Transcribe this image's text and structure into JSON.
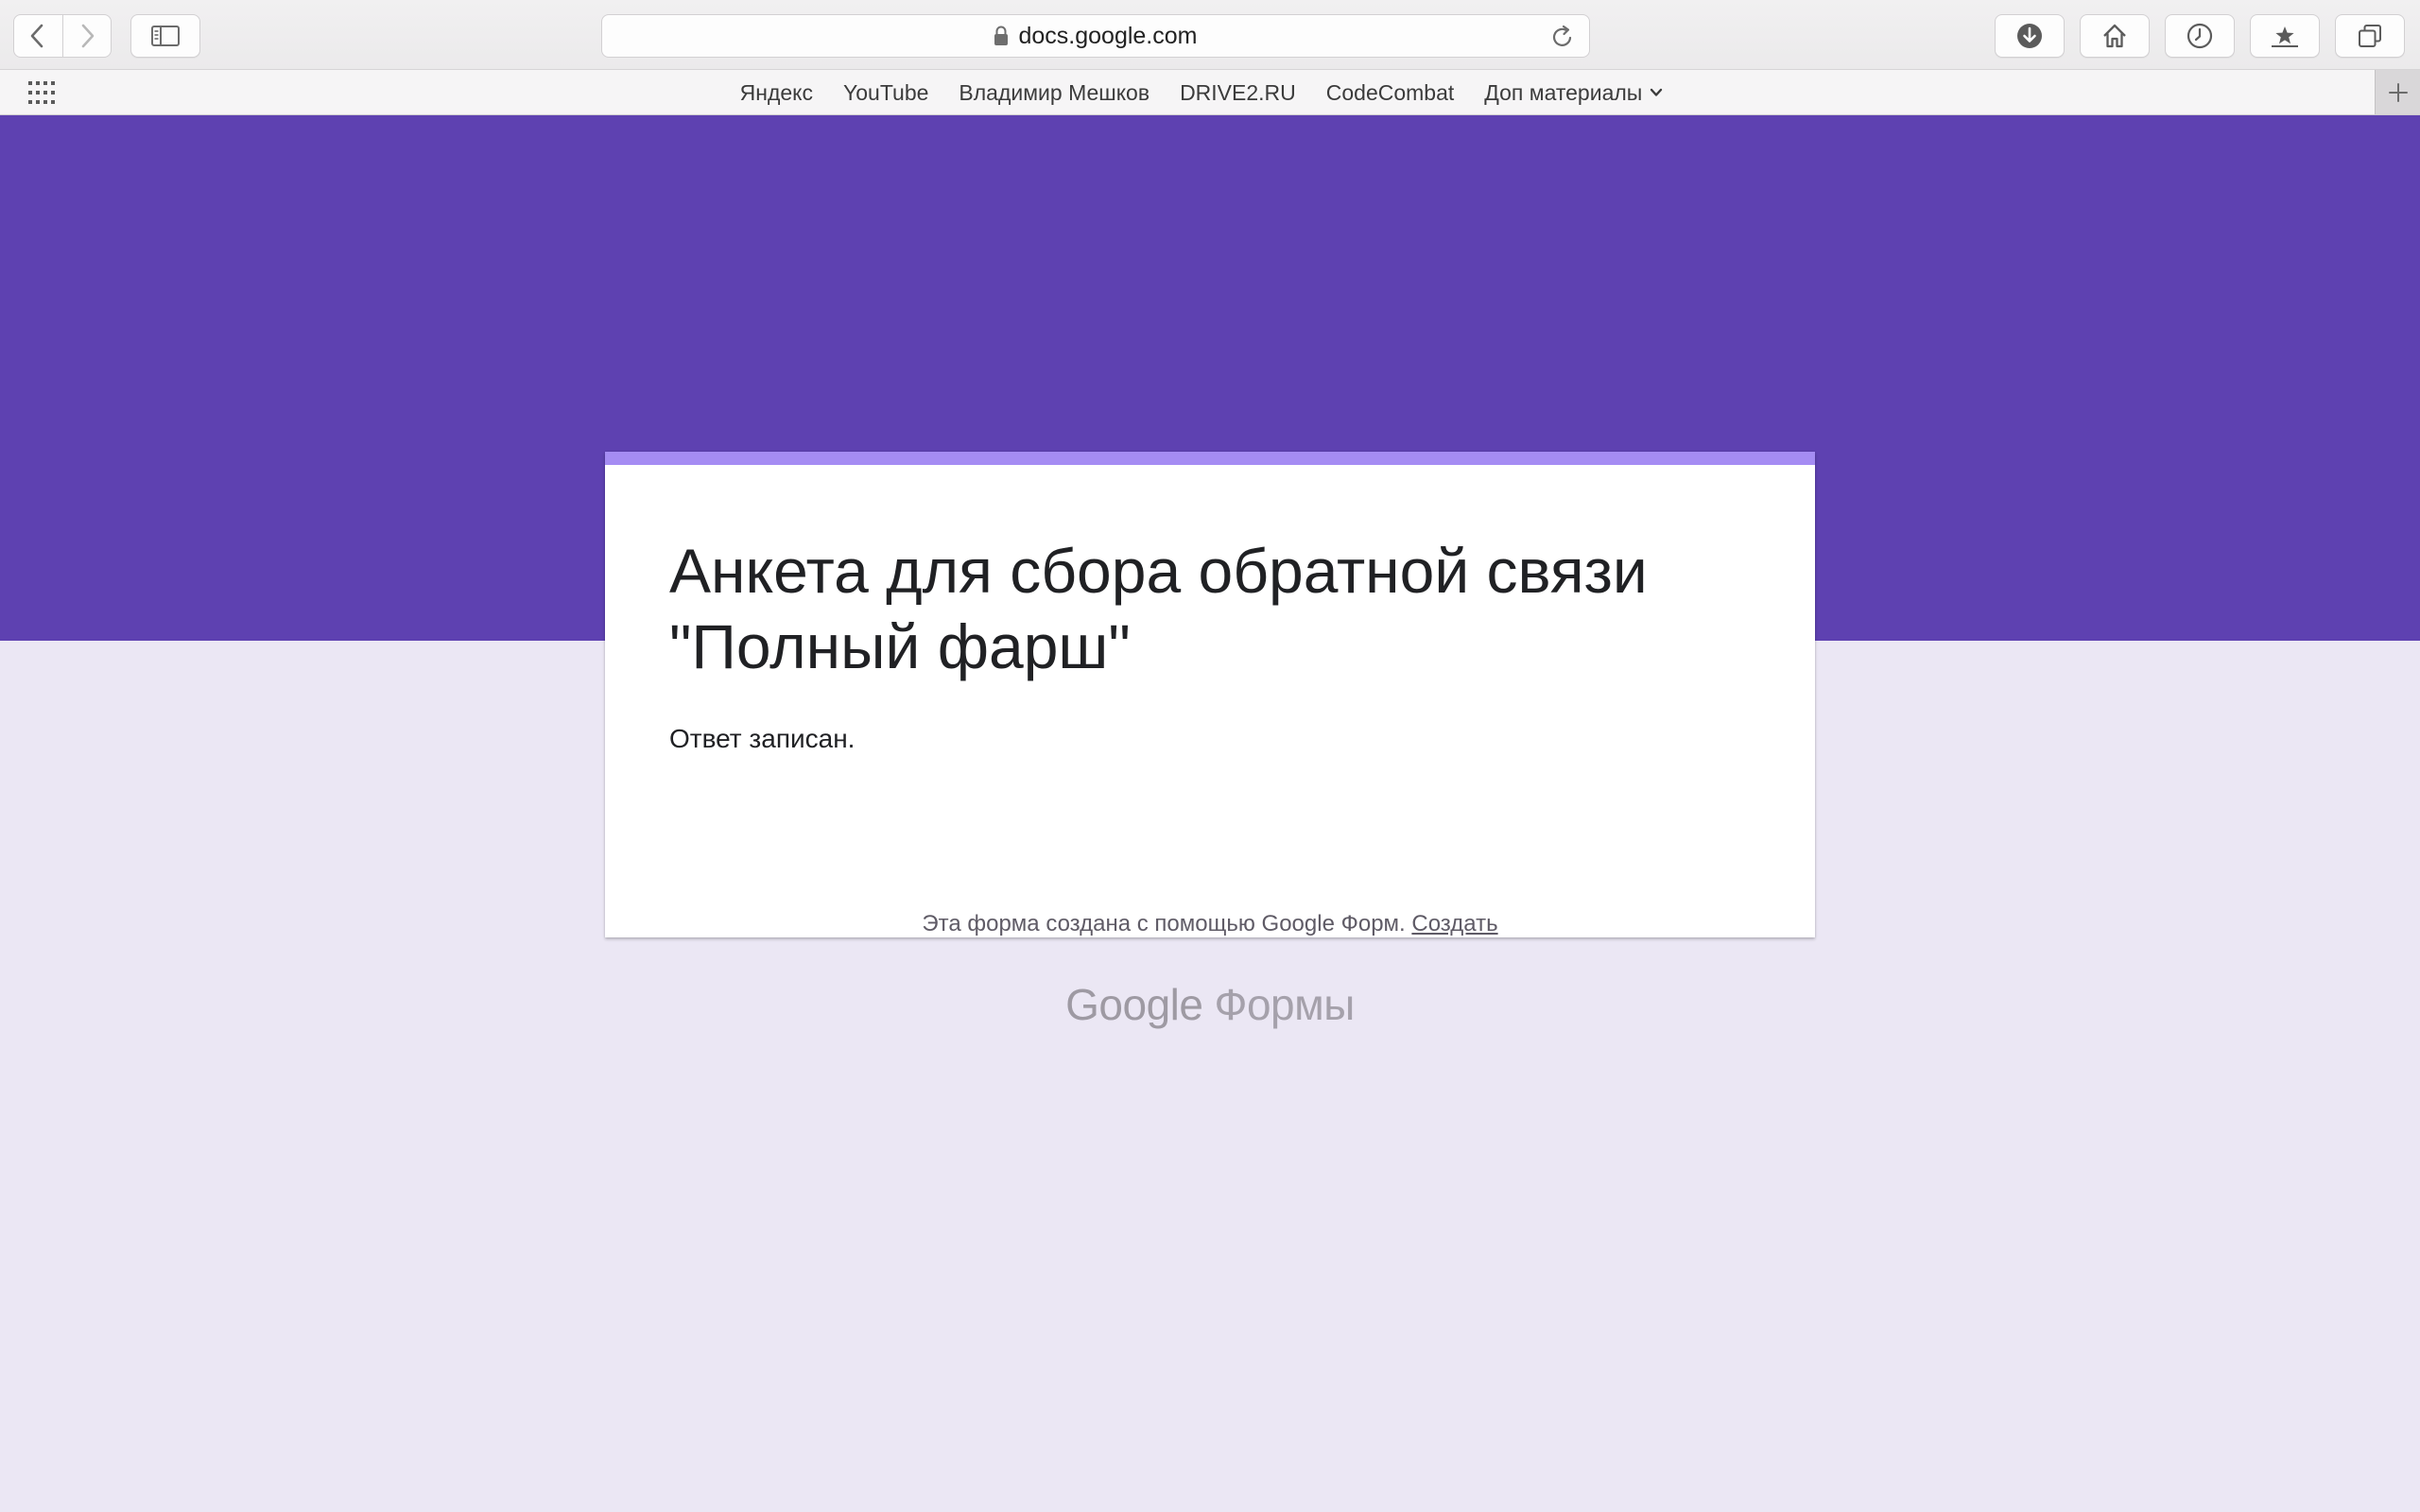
{
  "browser": {
    "url": "docs.google.com"
  },
  "bookmarks": {
    "items": [
      {
        "label": "Яндекс"
      },
      {
        "label": "YouTube"
      },
      {
        "label": "Владимир Мешков"
      },
      {
        "label": "DRIVE2.RU"
      },
      {
        "label": "CodeCombat"
      },
      {
        "label": "Доп материалы"
      }
    ]
  },
  "form": {
    "title": "Анкета для сбора обратной связи \"Полный фарш\"",
    "message": "Ответ записан."
  },
  "footer": {
    "text": "Эта форма создана с помощью Google Форм.",
    "link": "Создать",
    "logo_google": "Google",
    "logo_product": "Формы"
  },
  "colors": {
    "banner": "#5e41b1",
    "card_accent": "#a58cf3",
    "page_bg": "#ebe7f4"
  }
}
